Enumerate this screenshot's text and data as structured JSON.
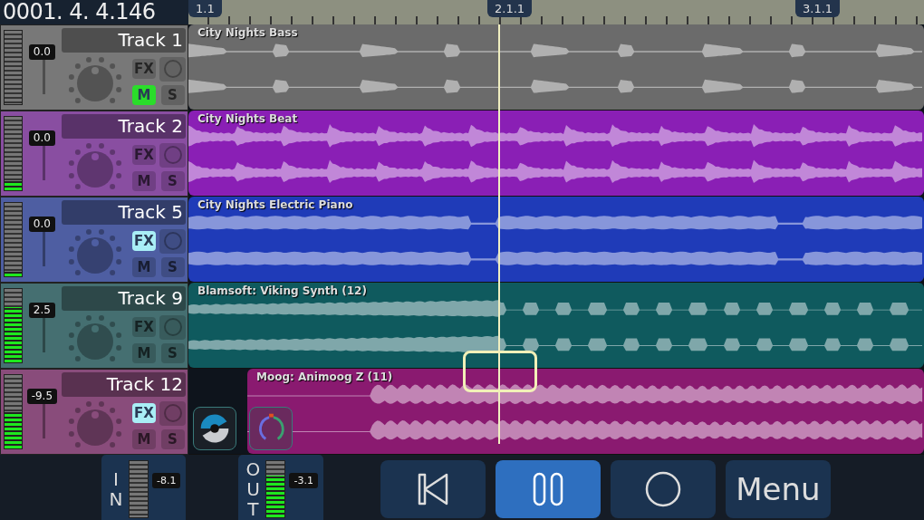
{
  "time_display": "0001. 4. 4.146",
  "ruler": {
    "markers": [
      "1.1",
      "2.1.1",
      "3.1.1"
    ]
  },
  "tracks": [
    {
      "name": "Track 1",
      "color": "#6b6b6b",
      "volume": "0.0",
      "meter": {
        "level": 0
      },
      "clip": {
        "title": "City Nights Bass"
      },
      "buttons": [
        {
          "kind": "fx",
          "label": "FX",
          "on": false
        },
        {
          "kind": "mute",
          "label": "M",
          "on": true
        },
        {
          "kind": "solo",
          "label": "S",
          "on": false
        }
      ]
    },
    {
      "name": "Track 2",
      "color": "#8a1fb5",
      "volume": "0.0",
      "meter": {
        "level": 0.12
      },
      "clip": {
        "title": "City Nights Beat"
      },
      "buttons": [
        {
          "kind": "fx",
          "label": "FX",
          "on": false
        },
        {
          "kind": "mute",
          "label": "M",
          "on": false
        },
        {
          "kind": "solo",
          "label": "S",
          "on": false
        }
      ]
    },
    {
      "name": "Track 5",
      "color": "#1f3bb8",
      "volume": "0.0",
      "meter": {
        "level": 0.06
      },
      "clip": {
        "title": "City Nights Electric Piano"
      },
      "buttons": [
        {
          "kind": "fx",
          "label": "FX",
          "on": true
        },
        {
          "kind": "mute",
          "label": "M",
          "on": false
        },
        {
          "kind": "solo",
          "label": "S",
          "on": false
        }
      ]
    },
    {
      "name": "Track 9",
      "color": "#0f5a5e",
      "volume": "2.5",
      "meter": {
        "level": 0.75
      },
      "clip": {
        "title": "Blamsoft: Viking Synth (12)"
      },
      "buttons": [
        {
          "kind": "fx",
          "label": "FX",
          "on": false
        },
        {
          "kind": "mute",
          "label": "M",
          "on": false
        },
        {
          "kind": "solo",
          "label": "S",
          "on": false
        }
      ]
    },
    {
      "name": "Track 12",
      "color": "#8a1a70",
      "volume": "-9.5",
      "meter": {
        "level": 0.5
      },
      "clip": {
        "title": "Moog: Animoog Z (11)"
      },
      "plugins": true,
      "buttons": [
        {
          "kind": "fx",
          "label": "FX",
          "on": true
        },
        {
          "kind": "mute",
          "label": "M",
          "on": false
        },
        {
          "kind": "solo",
          "label": "S",
          "on": false
        }
      ]
    }
  ],
  "input": {
    "label": "IN",
    "value": "-8.1"
  },
  "output": {
    "label": "OUT",
    "value": "-3.1",
    "level": 0.75
  },
  "transport": [
    {
      "kind": "rewind",
      "active": false
    },
    {
      "kind": "pause",
      "active": true
    },
    {
      "kind": "record",
      "active": false
    },
    {
      "kind": "menu",
      "label": "Menu",
      "active": false
    }
  ]
}
